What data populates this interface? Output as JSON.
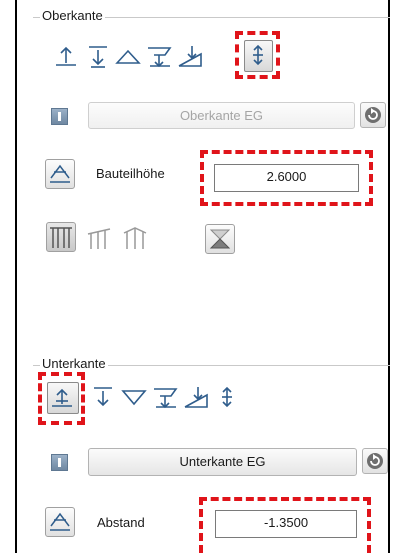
{
  "upper": {
    "title": "Oberkante",
    "icons": [
      "up-arrow-plane-icon",
      "down-arrow-plane-icon",
      "triangle-roof-icon",
      "funnel-down-icon",
      "slope-down-icon",
      "double-arrow-vertical-icon"
    ],
    "selected_icon": "double-arrow-vertical-icon",
    "reference_button": "Oberkante EG",
    "reference_enabled": false,
    "field_label": "Bauteilhöhe",
    "field_value": "2.6000",
    "roof_icons": [
      "flat-roof-frame-icon",
      "shed-roof-frame-icon",
      "gable-roof-frame-icon"
    ],
    "extra_icon": "hourglass-icon"
  },
  "lower": {
    "title": "Unterkante",
    "icons": [
      "up-arrow-plane-icon",
      "down-arrow-plane-icon",
      "triangle-down-icon",
      "funnel-down-icon",
      "slope-down-icon",
      "double-arrow-vertical-icon"
    ],
    "selected_icon": "up-arrow-plane-icon",
    "reference_button": "Unterkante EG",
    "reference_enabled": true,
    "field_label": "Abstand",
    "field_value": "-1.3500"
  },
  "colors": {
    "highlight": "#e0141a",
    "icon_stroke": "#2f5d8c",
    "info_blue": "#6f88a2"
  }
}
